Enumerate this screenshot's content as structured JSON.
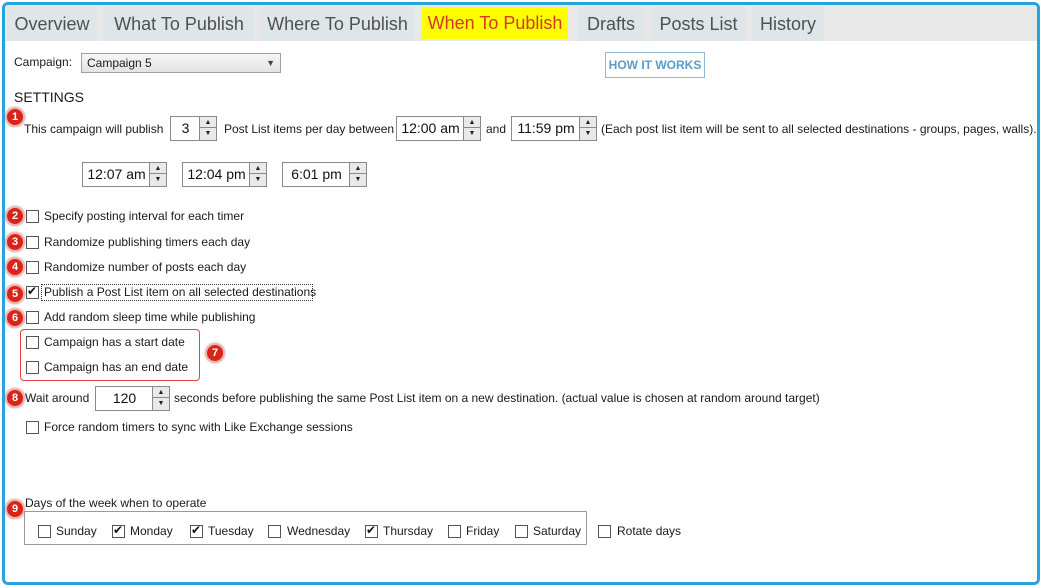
{
  "tabs": [
    {
      "label": "Overview",
      "active": false
    },
    {
      "label": "What To Publish",
      "active": false
    },
    {
      "label": "Where To Publish",
      "active": false
    },
    {
      "label": "When To Publish",
      "active": true
    },
    {
      "label": "Drafts",
      "active": false
    },
    {
      "label": "Posts List",
      "active": false
    },
    {
      "label": "History",
      "active": false
    }
  ],
  "campaign": {
    "label": "Campaign:",
    "selected": "Campaign 5"
  },
  "how_it_works": "HOW IT WORKS",
  "settings_title": "SETTINGS",
  "publish_row": {
    "prefix": "This campaign will publish",
    "count": "3",
    "mid": "Post List items per day between",
    "start_time": "12:00 am",
    "and": "and",
    "end_time": "11:59 pm",
    "note": "(Each post list item will be sent to all selected destinations - groups, pages, walls)."
  },
  "timers": [
    "12:07 am",
    "12:04 pm",
    "6:01 pm"
  ],
  "options": [
    {
      "label": "Specify posting interval for each timer",
      "checked": false
    },
    {
      "label": "Randomize publishing timers each day",
      "checked": false
    },
    {
      "label": "Randomize number of posts each day",
      "checked": false
    },
    {
      "label": "Publish a Post List item on all selected destinations",
      "checked": true
    },
    {
      "label": "Add random sleep time while publishing",
      "checked": false
    },
    {
      "label": "Campaign has a start date",
      "checked": false
    },
    {
      "label": "Campaign has an end date",
      "checked": false
    }
  ],
  "wait_row": {
    "prefix": "Wait around",
    "value": "120",
    "suffix": "seconds before publishing the same Post List item on a new destination. (actual value is chosen at random around target)"
  },
  "force_sync": {
    "label": "Force random timers to sync with Like Exchange sessions",
    "checked": false
  },
  "days": {
    "title": "Days of the week when to operate",
    "items": [
      {
        "label": "Sunday",
        "checked": false
      },
      {
        "label": "Monday",
        "checked": true
      },
      {
        "label": "Tuesday",
        "checked": true
      },
      {
        "label": "Wednesday",
        "checked": false
      },
      {
        "label": "Thursday",
        "checked": true
      },
      {
        "label": "Friday",
        "checked": false
      },
      {
        "label": "Saturday",
        "checked": false
      }
    ],
    "rotate": {
      "label": "Rotate days",
      "checked": false
    }
  },
  "badges": [
    "1",
    "2",
    "3",
    "4",
    "5",
    "6",
    "7",
    "8",
    "9"
  ],
  "colors": {
    "frame": "#2aa3dd",
    "active_tab_bg": "#ffff00",
    "active_tab_text": "#d33a1e",
    "badge": "#d9241c",
    "how_btn_text": "#5b9bc8"
  }
}
